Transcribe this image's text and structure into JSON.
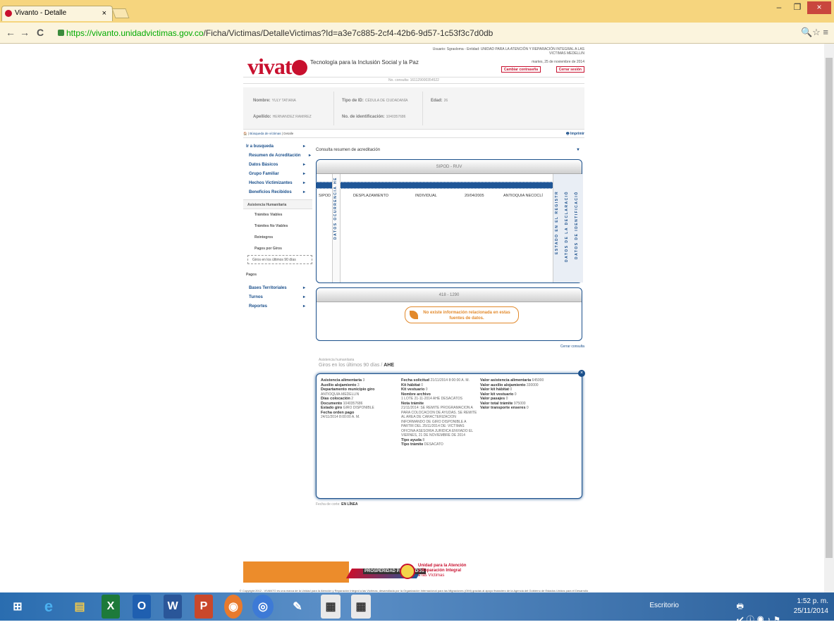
{
  "browser": {
    "tab_title": "Vivanto - Detalle",
    "tab_close": "×",
    "url_scheme_host": "https://vivanto.unidadvictimas.gov.co",
    "url_path": "/Ficha/Victimas/DetalleVictimas?Id=a3e7c885-2cf4-42b6-9d57-1c53f3c7d0db",
    "back": "←",
    "forward": "→",
    "reload": "C",
    "toolbar_icons": "🔍☆ ≡"
  },
  "header": {
    "logo_text": "viva",
    "logo_suffix": "t",
    "tagline": "Tecnología para la Inclusión Social y la Paz",
    "user_line": "Usuario: Sgrasloma - Entidad: UNIDAD PARA LA ATENCIÓN Y REPARACIÓN INTEGRAL A LAS VICTIMAS MEDELLIN",
    "date": "martes, 25 de noviembre de 2014",
    "change_password": "Cambiar contraseña",
    "logout": "Cerrar sesión",
    "consult_no": "No. consulta: 161129000354522"
  },
  "person": {
    "nombre_label": "Nombre:",
    "nombre": "YULY TATIANA",
    "apellido_label": "Apellido:",
    "apellido": "HERNANDEZ RAMIREZ",
    "tipo_id_label": "Tipo de ID:",
    "tipo_id": "CÉDULA DE CIUDADANÍA",
    "num_id_label": "No. de identificación:",
    "num_id": "1040357686",
    "edad_label": "Edad:",
    "edad": "26"
  },
  "breadcrumb": {
    "home": "🏠",
    "item1": "Búsqueda de víctimas",
    "item2": "Detalle",
    "print": "Imprimir"
  },
  "menu": {
    "items": [
      "Ir a busqueda",
      "Resumen de Acreditación",
      "Datos Básicos",
      "Grupo Familiar",
      "Hechos Victimizantes",
      "Beneficios Recibidos"
    ],
    "subheader": "Asistencia Humanitaria",
    "subitems": [
      "Trámites Viables",
      "Trámites No Viables",
      "Reintegros",
      "Pagos por Giros"
    ],
    "selected_sub": "Giros en los últimos 90 días",
    "pagos": "Pagos",
    "items2": [
      "Bases Territoriales",
      "Turnos",
      "Reportes"
    ]
  },
  "content": {
    "title": "Consulta resumen de acreditación",
    "panel1_title": "SIPOD - RUV",
    "row": [
      "SIPOD",
      "DESPLAZAMIENTO",
      "INDIVIDUAL",
      "20/04/2005",
      "ANTIOQUIA NECOCLÍ"
    ],
    "vert_labels": [
      "DATOS OCURRENCIA HE",
      "ESTADO EN EL REGISTR",
      "DATOS DE LA DECLARACIÓ",
      "DATOS DE IDENTIFICACIÓ"
    ],
    "panel2_title": "418 - 1290",
    "no_data": "No existe información relacionada en estas fuentes de datos.",
    "close_consult": "Cerrar consulta"
  },
  "ahe": {
    "small_header": "Asistencia humanitaria",
    "title_prefix": "Giros en los últimos 90 días / ",
    "title_bold": "AHE",
    "col1": [
      {
        "label": "Asistencia alimentaria",
        "value": "3"
      },
      {
        "label": "Auxilio alojamiento",
        "value": "3"
      },
      {
        "label": "Departamento municipio giro",
        "value": "ANTIOQUIA-MEDELLIN"
      },
      {
        "label": "Días colocación",
        "value": "2"
      },
      {
        "label": "Documento",
        "value": "1040357686"
      },
      {
        "label": "Estado giro",
        "value": "GIRO DISPONIBLE"
      },
      {
        "label": "Fecha orden pago",
        "value": "24/11/2014 8:00:00 A. M."
      }
    ],
    "col2": [
      {
        "label": "Fecha solicitud",
        "value": "21/11/2014 8:00:00 A. M."
      },
      {
        "label": "Kit hábitat",
        "value": "0"
      },
      {
        "label": "Kit vestuario",
        "value": "0"
      },
      {
        "label": "Nombre archivo",
        "value": "1 LOTE 21-11-2014 AHE DESACATOS"
      },
      {
        "label": "Nota trámite",
        "value": "21/11/2014: SE REMITE PROGRAMACION A PARA COLOCACION DE AYUDAS. SE REMITE AL AREA DE CARACTERIZACION INFORMANDO DE GIRO DISPONIBLE A PARTIR DEL 25/11/2014 DE: VICTIMAS OFICINA ASESORIA JURIDICA ENVIADO EL VIERNES, 21 DE NOVIEMBRE DE 2014"
      },
      {
        "label": "Tipo ayuda",
        "value": "8"
      },
      {
        "label": "Tipo trámite",
        "value": "DESACATO"
      }
    ],
    "col3": [
      {
        "label": "Valor asistencia alimentaria",
        "value": "645000"
      },
      {
        "label": "Valor auxilio alojamiento",
        "value": "330000"
      },
      {
        "label": "Valor kit hábitat",
        "value": "0"
      },
      {
        "label": "Valor kit vestuario",
        "value": "0"
      },
      {
        "label": "Valor pasajes",
        "value": "0"
      },
      {
        "label": "Valor total trámite",
        "value": "975000"
      },
      {
        "label": "Valor transporte enseres",
        "value": "0"
      }
    ],
    "fecha_corte_label": "Fecha de corte:",
    "fecha_corte": "EN LÍNEA"
  },
  "footer": {
    "prosperidad": "PROSPERIDAD PARA TODOS",
    "unidad_l1": "Unidad para la Atención",
    "unidad_l2": "y Reparación Integral",
    "unidad_l3": "a las Víctimas",
    "copyright": "© Copyright 2012 - VIVANTO es una marca de la Unidad para la Atención y Reparación Integral a las Víctimas, desarrollada por la Organización Internacional para las Migraciones (OIM) gracias al apoyo financiero de la Agencia del Gobierno de Estados Unidos para el Desarrollo Internacional (USAID). Cualquier copia o adaptación de este Software es ilegal."
  },
  "taskbar": {
    "escritorio": "Escritorio",
    "time": "1:52 p. m.",
    "date": "25/11/2014"
  }
}
